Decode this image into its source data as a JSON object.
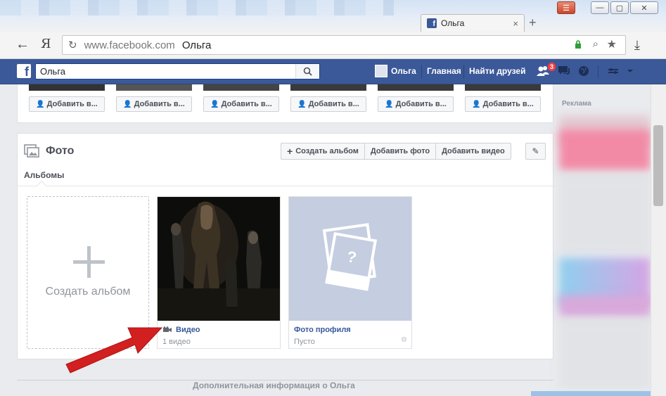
{
  "browser": {
    "tab_title": "Ольга",
    "new_tab": "+",
    "tab_close": "×",
    "url": "www.facebook.com",
    "url_page_title": "Ольга",
    "back": "←",
    "yandex": "Я",
    "reload": "↻",
    "download": "⤓",
    "win_menu": "☰",
    "win_min": "—",
    "win_max": "▢",
    "win_close": "✕"
  },
  "fb_nav": {
    "search_value": "Ольга",
    "profile_name": "Ольга",
    "home": "Главная",
    "find_friends": "Найти друзей",
    "friend_requests_count": "3"
  },
  "friends": {
    "add_button_label": "Добавить в..."
  },
  "photos": {
    "title": "Фото",
    "create_album_btn": "Создать альбом",
    "add_photo_btn": "Добавить фото",
    "add_video_btn": "Добавить видео",
    "albums_tab": "Альбомы",
    "create_album_tile": "Создать альбом",
    "albums": [
      {
        "name": "Видео",
        "subtitle": "1 видео"
      },
      {
        "name": "Фото профиля",
        "subtitle": "Пусто"
      }
    ]
  },
  "more_info": "Дополнительная информация о Ольга",
  "sidebar": {
    "ads_title": "Реклама"
  },
  "colors": {
    "fb_blue": "#3b5998",
    "arrow_red": "#d21f1f",
    "badge_red": "#fa3e3e"
  }
}
